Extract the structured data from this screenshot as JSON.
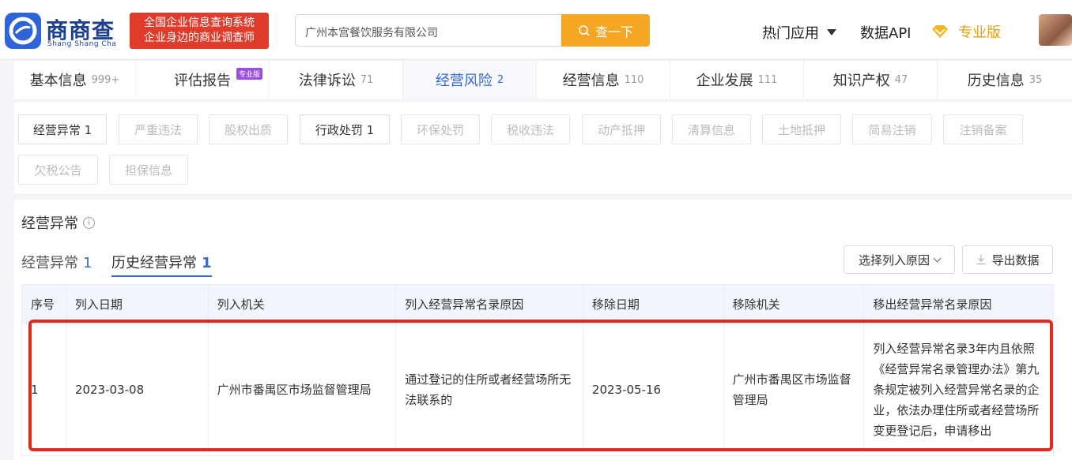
{
  "header": {
    "logo_cn": "商商查",
    "logo_en": "Shang Shang Cha",
    "slogan_line1": "全国企业信息查询系统",
    "slogan_line2": "企业身边的商业调查师",
    "search_value": "广州本宫餐饮服务有限公司",
    "search_button": "查一下",
    "nav_hot": "热门应用",
    "nav_api": "数据API",
    "nav_pro": "专业版"
  },
  "tabs": [
    {
      "label": "基本信息",
      "count": "999+"
    },
    {
      "label": "评估报告",
      "count": "",
      "badge": "专业版"
    },
    {
      "label": "法律诉讼",
      "count": "71"
    },
    {
      "label": "经营风险",
      "count": "2"
    },
    {
      "label": "经营信息",
      "count": "110"
    },
    {
      "label": "企业发展",
      "count": "111"
    },
    {
      "label": "知识产权",
      "count": "47"
    },
    {
      "label": "历史信息",
      "count": "35"
    }
  ],
  "filters": [
    {
      "label": "经营异常 1"
    },
    {
      "label": "严重违法"
    },
    {
      "label": "股权出质"
    },
    {
      "label": "行政处罚 1"
    },
    {
      "label": "环保处罚"
    },
    {
      "label": "税收违法"
    },
    {
      "label": "动产抵押"
    },
    {
      "label": "清算信息"
    },
    {
      "label": "土地抵押"
    },
    {
      "label": "简易注销"
    },
    {
      "label": "注销备案"
    },
    {
      "label": "欠税公告"
    },
    {
      "label": "担保信息"
    }
  ],
  "section": {
    "title": "经营异常",
    "info": "i",
    "subtab1_label": "经营异常",
    "subtab1_count": "1",
    "subtab2_label": "历史经营异常",
    "subtab2_count": "1",
    "select_reason": "选择列入原因",
    "export": "导出数据"
  },
  "table": {
    "headers": [
      "序号",
      "列入日期",
      "列入机关",
      "列入经营异常名录原因",
      "移除日期",
      "移除机关",
      "移出经营异常名录原因"
    ],
    "rows": [
      {
        "index": "1",
        "list_date": "2023-03-08",
        "list_authority": "广州市番禺区市场监督管理局",
        "list_reason": "通过登记的住所或者经营场所无法联系的",
        "remove_date": "2023-05-16",
        "remove_authority": "广州市番禺区市场监督管理局",
        "remove_reason": "列入经营异常名录3年内且依照《经营异常名录管理办法》第九条规定被列入经营异常名录的企业，依法办理住所或者经营场所变更登记后，申请移出"
      }
    ]
  },
  "colors": {
    "accent": "#3569d4",
    "search_button": "#f5a623",
    "slogan_bg": "#e03c2c",
    "highlight_border": "#e02a1f",
    "pro": "#e5a20b"
  }
}
